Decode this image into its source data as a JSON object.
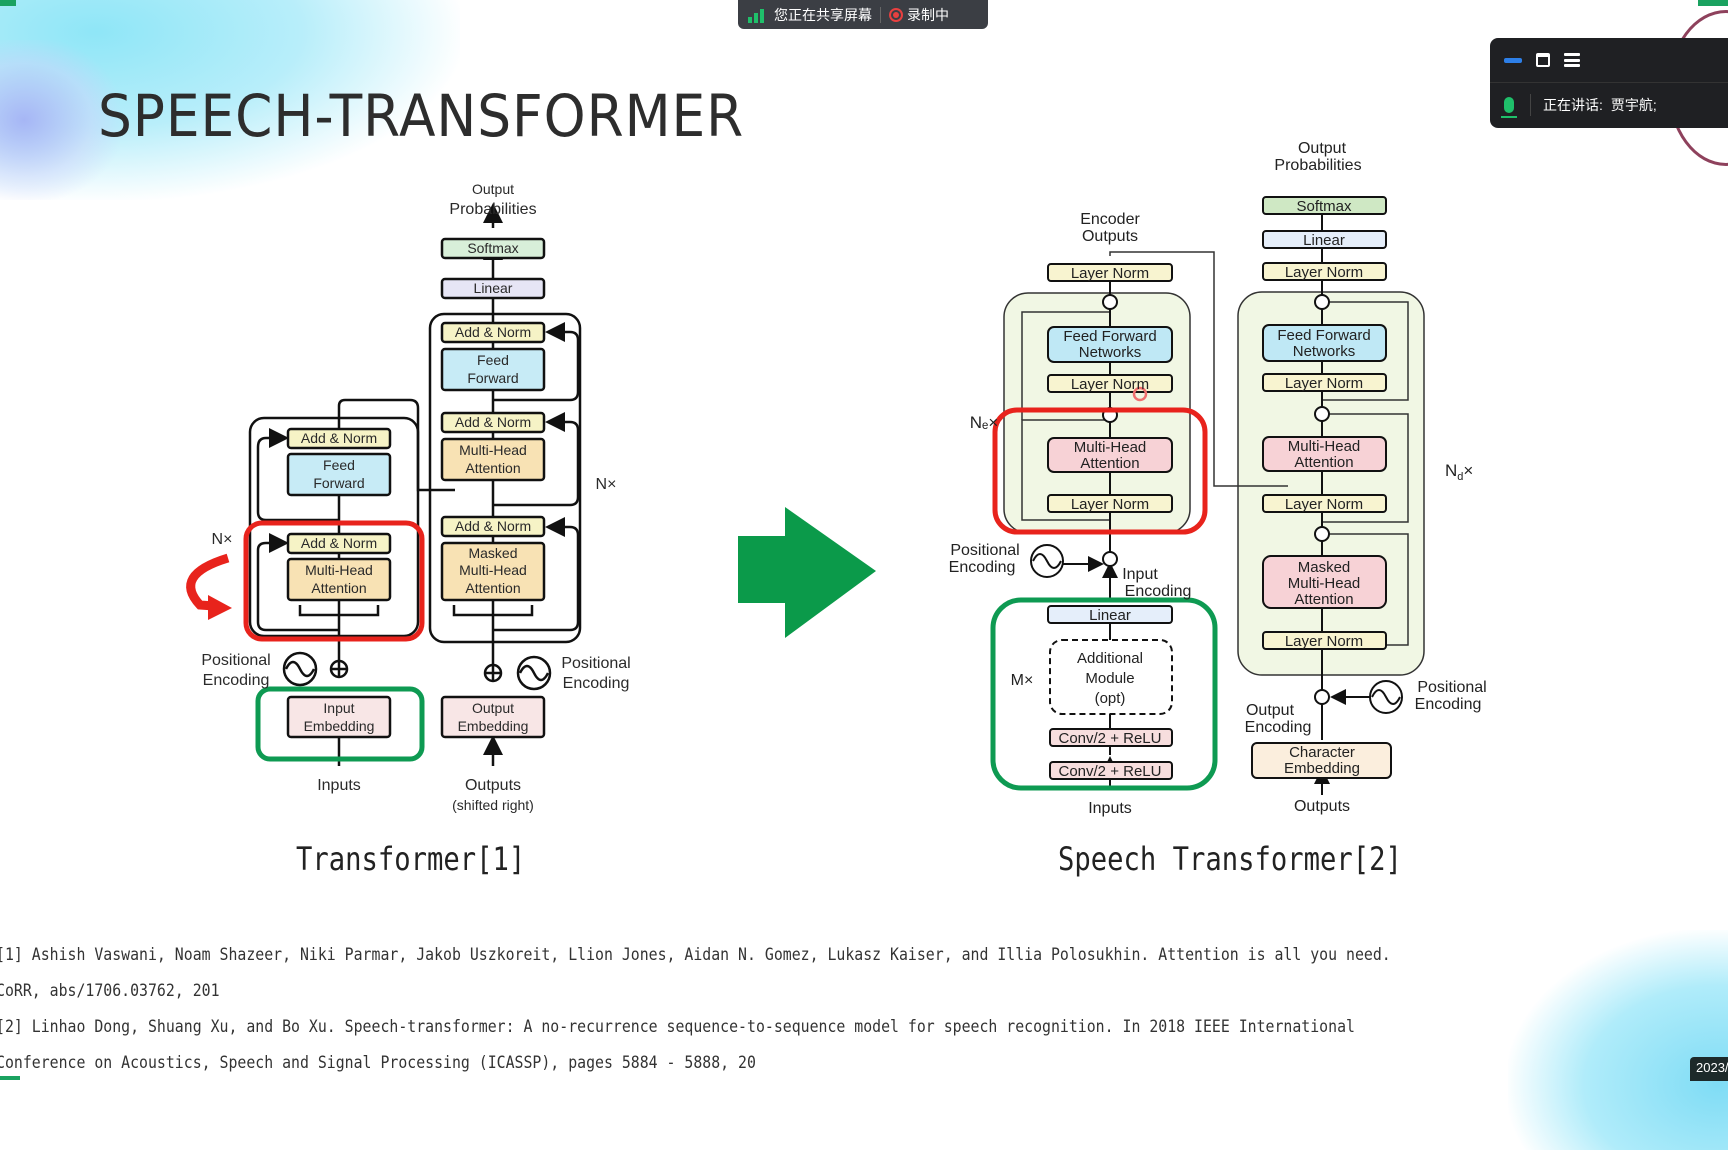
{
  "screen_share_bar": {
    "sharing_label": "您正在共享屏幕",
    "recording_label": "录制中",
    "signal_icon": "signal-bars-icon",
    "record_icon": "record-dot-icon"
  },
  "speaker_panel": {
    "tools": [
      "minimize-icon",
      "window-icon",
      "list-icon"
    ],
    "speaking_label": "正在讲话:",
    "speaker_name": "贾宇航;"
  },
  "slide": {
    "title": "SPEECH-TRANSFORMER",
    "left_caption": "Transformer[1]",
    "right_caption": "Speech Transformer[2]",
    "references": [
      "[1]  Ashish Vaswani, Noam Shazeer, Niki Parmar, Jakob Uszkoreit, Llion Jones, Aidan N. Gomez, Lukasz Kaiser, and Illia Polosukhin. Attention is all you need.",
      "CoRR, abs/1706.03762, 201",
      "[2]  Linhao Dong, Shuang Xu, and Bo Xu. Speech-transformer: A no-recurrence sequence-to-sequence model for speech recognition. In 2018 IEEE International",
      "Conference on Acoustics, Speech and Signal Processing (ICASSP), pages 5884 - 5888, 20"
    ],
    "date_badge": "2023/"
  },
  "transformer": {
    "output_probabilities": [
      "Output",
      "Probabilities"
    ],
    "softmax": "Softmax",
    "linear": "Linear",
    "add_norm": "Add & Norm",
    "feed_forward": [
      "Feed",
      "Forward"
    ],
    "multi_head": [
      "Multi-Head",
      "Attention"
    ],
    "masked_multi_head": [
      "Masked",
      "Multi-Head",
      "Attention"
    ],
    "nx": "N×",
    "positional_encoding": [
      "Positional",
      "Encoding"
    ],
    "input_embedding": [
      "Input",
      "Embedding"
    ],
    "output_embedding": [
      "Output",
      "Embedding"
    ],
    "inputs": "Inputs",
    "outputs": [
      "Outputs",
      "(shifted right)"
    ]
  },
  "speech_transformer": {
    "encoder_outputs": [
      "Encoder",
      "Outputs"
    ],
    "output_probabilities": [
      "Output",
      "Probabilities"
    ],
    "softmax": "Softmax",
    "linear": "Linear",
    "layer_norm": "Layer Norm",
    "ffn": [
      "Feed Forward",
      "Networks"
    ],
    "multi_head": [
      "Multi-Head",
      "Attention"
    ],
    "masked_multi_head": [
      "Masked",
      "Multi-Head",
      "Attention"
    ],
    "ne": "Nₑ×",
    "nd": "N",
    "nd_sub": "d",
    "nd_x": "×",
    "positional_encoding": [
      "Positional",
      "Encoding"
    ],
    "input_encoding": [
      "Input",
      "Encoding"
    ],
    "output_encoding": [
      "Output",
      "Encoding"
    ],
    "additional_module": [
      "Additional",
      "Module",
      "(opt)"
    ],
    "mx": "M×",
    "conv": "Conv/2 + ReLU",
    "character_embedding": [
      "Character",
      "Embedding"
    ],
    "inputs": "Inputs",
    "outputs": "Outputs"
  },
  "colors": {
    "highlight_red": "#e8231c",
    "highlight_green": "#0e9a52",
    "arrow_green": "#0b9a4a",
    "add_norm_fill": "#f6f3c6",
    "ff_fill": "#c7ebf6",
    "mha_fill": "#f8e2b4",
    "softmax_fill": "#d8efd9",
    "linear_fill": "#e6e5f5",
    "embed_fill": "#f8e6e6",
    "st_block_bg": "#f1f7e4",
    "st_mha_fill": "#f7d2d6",
    "st_softmax_fill": "#cfe8c4",
    "st_linear_fill": "#e5eefa"
  }
}
